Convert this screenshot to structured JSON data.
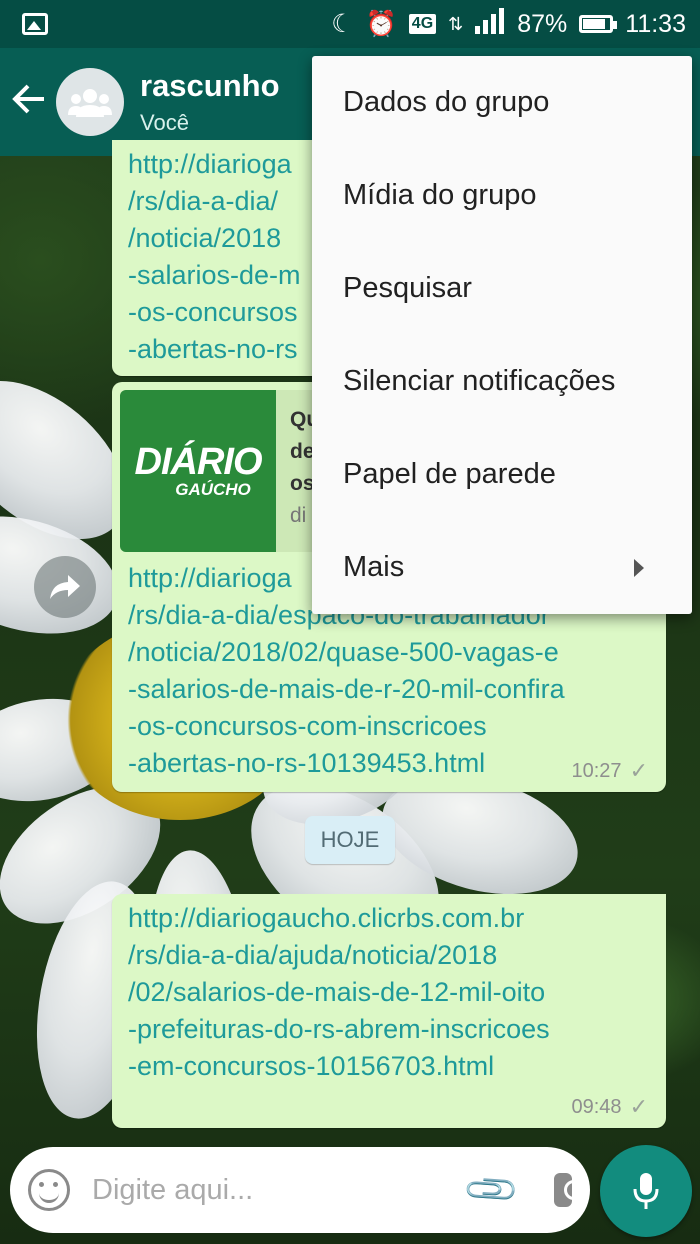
{
  "status_bar": {
    "battery": "87%",
    "time": "11:33",
    "network": "4G"
  },
  "header": {
    "title": "rascunho",
    "subtitle": "Você"
  },
  "messages": [
    {
      "text": "http://diariogaucho.clicrbs.com.br\n/rs/dia-a-dia/espaco-do-trabalhador\n/noticia/2018/02/quase-500-vagas-e\n-salarios-de-mais-de-r-20-mil-confira\n-os-concursos-com-inscricoes\n-abertas-no-rs-10139453.html",
      "visible_text": "http://diarioga\n/rs/dia-a-dia/\n/noticia/2018\n-salarios-de-m\n-os-concursos\n-abertas-no-rs"
    },
    {
      "preview": {
        "logo_main": "DIÁRIO",
        "logo_sub": "GAÚCHO",
        "title_visible": "Qu\nde\nos",
        "site_visible": "di"
      },
      "text": "http://diarioga\n/rs/dia-a-dia/espaco-do-trabalhador\n/noticia/2018/02/quase-500-vagas-e\n-salarios-de-mais-de-r-20-mil-confira\n-os-concursos-com-inscricoes\n-abertas-no-rs-10139453.html",
      "time": "10:27"
    },
    {
      "text": "http://diariogaucho.clicrbs.com.br\n/rs/dia-a-dia/ajuda/noticia/2018\n/02/salarios-de-mais-de-12-mil-oito\n-prefeituras-do-rs-abrem-inscricoes\n-em-concursos-10156703.html",
      "time": "09:48"
    }
  ],
  "date_divider": "HOJE",
  "composer": {
    "placeholder": "Digite aqui..."
  },
  "menu": {
    "items": [
      {
        "label": "Dados do grupo"
      },
      {
        "label": "Mídia do grupo"
      },
      {
        "label": "Pesquisar"
      },
      {
        "label": "Silenciar notificações"
      },
      {
        "label": "Papel de parede"
      },
      {
        "label": "Mais"
      }
    ]
  },
  "colors": {
    "status_bar": "#054d44",
    "app_bar": "#075e54",
    "bubble_out": "#dcf8c6",
    "link": "#1e9a9a",
    "mic_button": "#128c7e"
  }
}
